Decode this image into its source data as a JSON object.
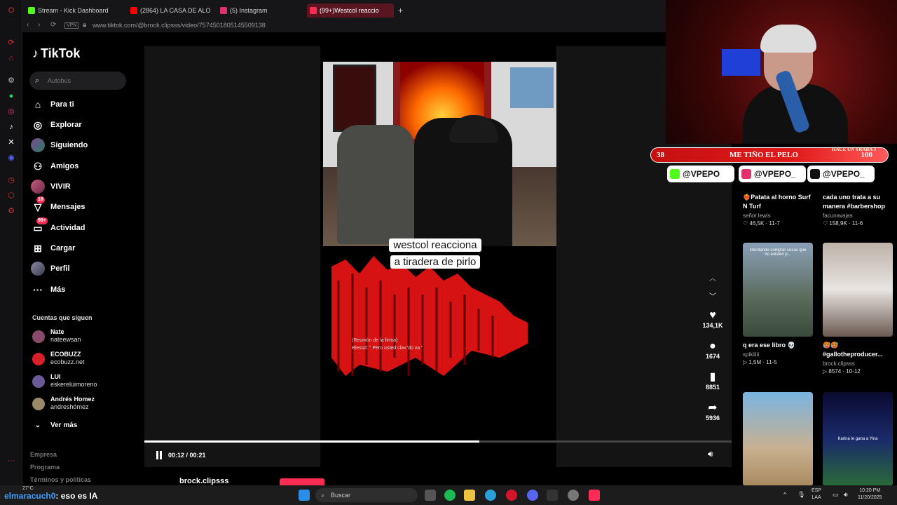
{
  "browser": {
    "tabs": [
      {
        "label": "Stream - Kick Dashboard",
        "color": "#53fc18"
      },
      {
        "label": "(2864) LA CASA DE ALO",
        "color": "#ff0000"
      },
      {
        "label": "(5) Instagram",
        "color": "#e1306c"
      },
      {
        "label": "(99+)Westcol reaccio",
        "color": "#fe2c55"
      }
    ],
    "url": "www.tiktok.com/@brock.clipsss/video/7574501805145509138"
  },
  "tiktok": {
    "logo": "TikTok",
    "search_placeholder": "Autobús",
    "nav": [
      {
        "label": "Para ti",
        "icon": "home-icon"
      },
      {
        "label": "Explorar",
        "icon": "compass-icon"
      },
      {
        "label": "Siguiendo",
        "icon": "avatar-icon"
      },
      {
        "label": "Amigos",
        "icon": "friends-icon"
      },
      {
        "label": "VIVIR",
        "icon": "live-icon"
      },
      {
        "label": "Mensajes",
        "icon": "messages-icon",
        "badge": "18"
      },
      {
        "label": "Actividad",
        "icon": "activity-icon",
        "badge": "99+"
      },
      {
        "label": "Cargar",
        "icon": "upload-icon"
      },
      {
        "label": "Perfil",
        "icon": "profile-icon"
      },
      {
        "label": "Más",
        "icon": "more-icon"
      }
    ],
    "following_title": "Cuentas que siguen",
    "following": [
      {
        "name": "Nate",
        "handle": "nateewsan",
        "color": "#8a4a6a"
      },
      {
        "name": "ECOBUZZ",
        "handle": "ecobuzz.net",
        "color": "#d9202a"
      },
      {
        "name": "LUI",
        "handle": "eskereluimoreno",
        "color": "#6a5a9a"
      },
      {
        "name": "Andrés Homez",
        "handle": "andreshómez",
        "color": "#9a8a6a"
      }
    ],
    "see_more": "Ver más",
    "footer": [
      "Empresa",
      "Programa",
      "Términos y políticas"
    ]
  },
  "video": {
    "caption_line1": "westcol reacciona",
    "caption_line2": "a tiradera de pirlo",
    "subtitle_line1": "(Reunión de la firma)",
    "subtitle_line2": "Blessd: \" Pero usted clav\"do va \"",
    "time": "00:12 / 00:21",
    "progress": 0.57,
    "author": "brock.clipsss",
    "likes": "134,1K",
    "comments": "1674",
    "saves": "8851",
    "shares": "5936"
  },
  "overlay": {
    "bar_left": "38",
    "bar_text": "ME TIÑO EL PELO",
    "bar_right": "100",
    "bar_tag": "HACE UN TRABA 3",
    "socials": [
      {
        "label": "@VPEPO",
        "color": "#53fc18"
      },
      {
        "label": "@VPEPO_",
        "color": "#e1306c"
      },
      {
        "label": "@VPEPO_",
        "color": "#111111"
      }
    ]
  },
  "related": [
    {
      "title": "Patata al horno Surf N Turf",
      "user": "señor.lewis",
      "likes": "46,5K",
      "date": "11-7"
    },
    {
      "title": "cada uno trata a su manera #barbershop",
      "user": "facunavajas",
      "likes": "158,9K",
      "date": "11-6"
    },
    {
      "title": "q era ese libro 💀",
      "user": "spikiiiii",
      "likes": "1,5M",
      "date": "11-5",
      "thumb_text": "intentando comprar cosas que no existen p..."
    },
    {
      "title": "🥵🥵 #gallotheproducer...",
      "user": "brock.clipsss",
      "likes": "8574",
      "date": "10-12"
    },
    {
      "title": "",
      "user": "",
      "likes": "",
      "date": ""
    },
    {
      "title": "",
      "user": "",
      "likes": "",
      "date": "",
      "thumb_text": "Karina le gana a Yina"
    }
  ],
  "chat": {
    "user": "elmaracuch0",
    "message": ": eso es IA"
  },
  "taskbar": {
    "weather": "27°C",
    "search": "Buscar",
    "lang1": "ESP",
    "lang2": "LAA",
    "time": "10:20 PM",
    "date": "11/20/2025"
  }
}
